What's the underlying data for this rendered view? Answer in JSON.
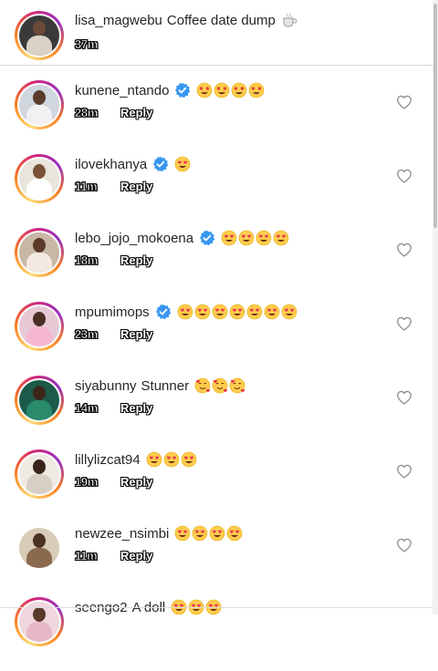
{
  "caption": {
    "username": "lisa_magwebu",
    "text": "Coffee date dump",
    "emoji_icon": "coffee-emoji-icon",
    "time": "37m"
  },
  "comments": [
    {
      "username": "kunene_ntando",
      "verified": true,
      "text": "",
      "emojis": [
        "star-struck",
        "star-struck",
        "star-struck",
        "star-struck"
      ],
      "time": "28m",
      "reply_label": "Reply"
    },
    {
      "username": "ilovekhanya",
      "verified": true,
      "text": "",
      "emojis": [
        "heart-eyes"
      ],
      "time": "11m",
      "reply_label": "Reply"
    },
    {
      "username": "lebo_jojo_mokoena",
      "verified": true,
      "text": "",
      "emojis": [
        "heart-eyes",
        "heart-eyes",
        "heart-eyes",
        "heart-eyes"
      ],
      "time": "18m",
      "reply_label": "Reply"
    },
    {
      "username": "mpumimops",
      "verified": true,
      "text": "",
      "emojis": [
        "heart-eyes",
        "heart-eyes",
        "heart-eyes",
        "heart-eyes",
        "heart-eyes",
        "heart-eyes",
        "heart-eyes"
      ],
      "time": "23m",
      "reply_label": "Reply"
    },
    {
      "username": "siyabunny",
      "verified": false,
      "text": "Stunner",
      "emojis": [
        "smiling-hearts",
        "smiling-hearts",
        "smiling-hearts"
      ],
      "time": "14m",
      "reply_label": "Reply"
    },
    {
      "username": "lillylizcat94",
      "verified": false,
      "text": "",
      "emojis": [
        "heart-eyes",
        "heart-eyes",
        "heart-eyes"
      ],
      "time": "19m",
      "reply_label": "Reply"
    },
    {
      "username": "newzee_nsimbi",
      "verified": false,
      "text": "",
      "emojis": [
        "heart-eyes",
        "heart-eyes",
        "heart-eyes",
        "heart-eyes"
      ],
      "time": "11m",
      "reply_label": "Reply"
    },
    {
      "username": "seengo2",
      "verified": false,
      "text": "A doll",
      "emojis": [
        "heart-eyes",
        "heart-eyes",
        "heart-eyes"
      ],
      "time": "",
      "reply_label": ""
    }
  ],
  "colors": {
    "verified_blue": "#3897f0",
    "text": "#262626",
    "divider": "#dbdbdb",
    "heart_outline": "#8e8e8e"
  }
}
